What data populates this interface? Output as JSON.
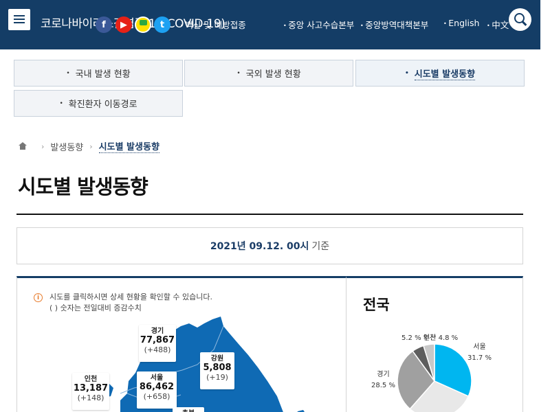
{
  "header": {
    "site_title": "코로나바이러스감염증-19(COVID-19)",
    "links": [
      "백신 및 예방접종",
      "중앙 사고수습본부",
      "중앙방역대책본부",
      "English",
      "中文"
    ]
  },
  "tabs": [
    "국내 발생 현황",
    "국외 발생 현황",
    "시도별 발생동향",
    "확진환자 이동경로"
  ],
  "breadcrumb": {
    "parent": "발생동향",
    "current": "시도별 발생동향"
  },
  "page_title": "시도별 발생동향",
  "date": {
    "value": "2021년 09.12. 00시",
    "suffix": "기준"
  },
  "info": {
    "line1": "시도를 클릭하시면 상세 현황을 확인할 수 있습니다.",
    "line2": "( ) 숫자는 전일대비 증감수치"
  },
  "regions": [
    {
      "name": "경기",
      "count": "77,867",
      "diff": "(+488)"
    },
    {
      "name": "강원",
      "count": "5,808",
      "diff": "(+19)"
    },
    {
      "name": "인천",
      "count": "13,187",
      "diff": "(+148)"
    },
    {
      "name": "서울",
      "count": "86,462",
      "diff": "(+658)"
    },
    {
      "name": "충북",
      "count": "",
      "diff": ""
    }
  ],
  "pie": {
    "title": "전국",
    "labels": [
      {
        "name": "서울",
        "pct": "31.7 %"
      },
      {
        "name": "경기",
        "pct": "28.5 %"
      },
      {
        "name": "인천",
        "pct": "5.2 %"
      },
      {
        "name": "부산",
        "pct": "4.8 %"
      }
    ],
    "slices": [
      {
        "pct": 31.7,
        "color": "#00b6f0"
      },
      {
        "pct": 29.8,
        "color": "#e8e8e8"
      },
      {
        "pct": 28.5,
        "color": "#a0a0a0"
      },
      {
        "pct": 5.2,
        "color": "#5e5e5e"
      },
      {
        "pct": 4.8,
        "color": "#c8c8c8"
      }
    ]
  },
  "colors": {
    "header_bg": "#143d66",
    "map_fill": "#0f6ab4",
    "accent": "#1a3c66"
  }
}
